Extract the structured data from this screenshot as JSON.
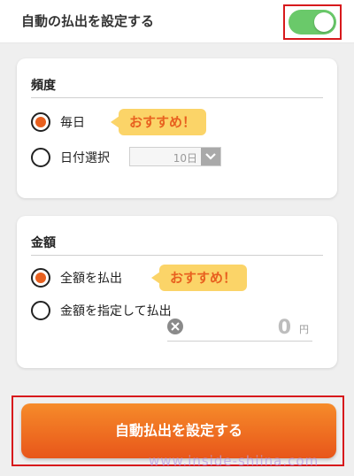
{
  "header": {
    "title": "自動の払出を設定する",
    "toggle_on": true
  },
  "frequency": {
    "title": "頻度",
    "options": [
      {
        "label": "毎日",
        "selected": true
      },
      {
        "label": "日付選択",
        "selected": false
      }
    ],
    "recommend_badge": "おすすめ！",
    "date_select_value": "10日"
  },
  "amount": {
    "title": "金額",
    "options": [
      {
        "label": "全額を払出",
        "selected": true
      },
      {
        "label": "金額を指定して払出",
        "selected": false
      }
    ],
    "recommend_badge": "おすすめ！",
    "input_value": "0",
    "input_unit": "円"
  },
  "submit_label": "自動払出を設定する",
  "watermark": "www.inside-shiina.com",
  "colors": {
    "accent_orange": "#e8601f",
    "toggle_green": "#6ac96a",
    "badge_yellow": "#fbd468",
    "highlight_red": "#d7191c"
  }
}
